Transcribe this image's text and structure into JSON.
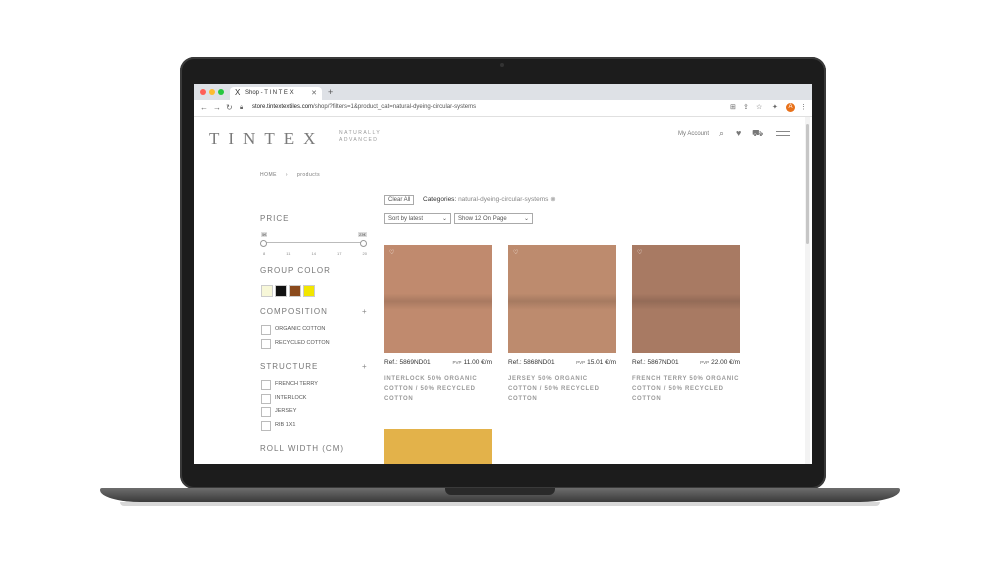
{
  "browser": {
    "tab_title": "Shop - T I N T E X",
    "tab_logo": "X",
    "url_host": "store.tintextextiles.com",
    "url_path": "/shop/?filters=1&product_cat=natural-dyeing-circular-systems",
    "profile_initial": "A"
  },
  "header": {
    "brand": "TINTEX",
    "tagline": "NATURALLY ADVANCED",
    "account_label": "My Account"
  },
  "breadcrumb": {
    "home": "HOME",
    "separator": "›",
    "current": "products"
  },
  "sidebar": {
    "price_title": "PRICE",
    "price_min_tag": "5€",
    "price_max_tag": "23€",
    "price_ticks": [
      "8",
      "11",
      "14",
      "17",
      "20"
    ],
    "group_color_title": "GROUP COLOR",
    "swatches": [
      "#f7f7d8",
      "#111111",
      "#8a4a1c",
      "#f2e600"
    ],
    "composition_title": "COMPOSITION",
    "composition_items": [
      "ORGANIC COTTON",
      "RECYCLED COTTON"
    ],
    "structure_title": "STRUCTURE",
    "structure_items": [
      "FRENCH TERRY",
      "INTERLOCK",
      "JERSEY",
      "RIB 1X1"
    ],
    "roll_width_title": "ROLL WIDTH (CM)",
    "plus": "+"
  },
  "filters": {
    "clear_label": "Clear All",
    "category_label": "Categories:",
    "category_value": "natural-dyeing-circular-systems",
    "category_remove": "⊗",
    "sort_value": "Sort by latest",
    "show_value": "Show 12 On Page"
  },
  "products": [
    {
      "ref": "Ref.: 5869ND01",
      "pvp": "PVP",
      "price": "11.00 €/m",
      "name": "INTERLOCK 50% ORGANIC COTTON / 50% RECYCLED COTTON",
      "color": "#c08a6e"
    },
    {
      "ref": "Ref.: 5868ND01",
      "pvp": "PVP",
      "price": "15.01 €/m",
      "name": "JERSEY 50% ORGANIC COTTON / 50% RECYCLED COTTON",
      "color": "#bd8b6e"
    },
    {
      "ref": "Ref.: 5867ND01",
      "pvp": "PVP",
      "price": "22.00 €/m",
      "name": "FRENCH TERRY 50% ORGANIC COTTON / 50% RECYCLED COTTON",
      "color": "#a87a63"
    },
    {
      "color": "#e3b24a"
    }
  ]
}
